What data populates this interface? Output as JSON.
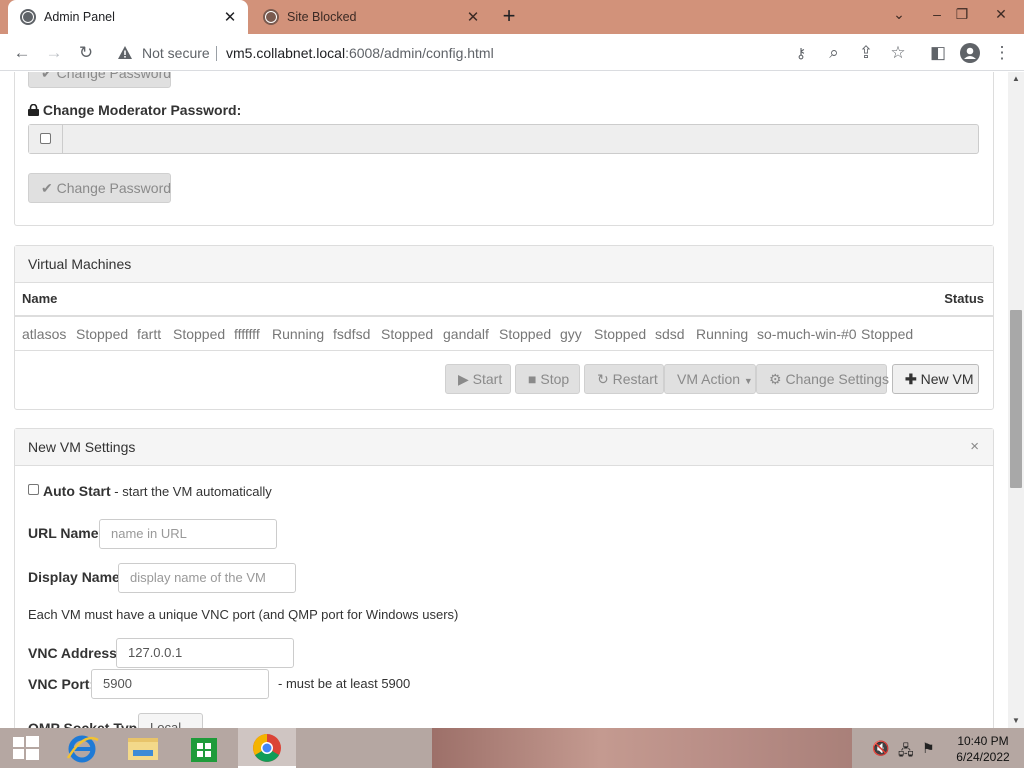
{
  "browser": {
    "tabs": [
      {
        "title": "Admin Panel",
        "active": true
      },
      {
        "title": "Site Blocked",
        "active": false
      }
    ],
    "new_tab": "+",
    "security_label": "Not secure",
    "url_host": "vm5.collabnet.local",
    "url_rest": ":6008/admin/config.html"
  },
  "password_section": {
    "change_password_label": "Change Password",
    "moderator_label": "Change Moderator Password:",
    "moderator_value": ""
  },
  "virtual_machines": {
    "heading": "Virtual Machines",
    "columns": [
      "Name",
      "Status"
    ],
    "entries": [
      {
        "name": "atlasos",
        "status": "Stopped"
      },
      {
        "name": "fartt",
        "status": "Stopped"
      },
      {
        "name": "fffffff",
        "status": "Running"
      },
      {
        "name": "fsdfsd",
        "status": "Stopped"
      },
      {
        "name": "gandalf",
        "status": "Stopped"
      },
      {
        "name": "gyy",
        "status": "Stopped"
      },
      {
        "name": "sdsd",
        "status": "Running"
      },
      {
        "name": "so-much-win-#0",
        "status": "Stopped"
      }
    ],
    "actions": {
      "start": "Start",
      "stop": "Stop",
      "restart": "Restart",
      "vm_action": "VM Action",
      "change_settings": "Change Settings",
      "new_vm": "New VM"
    }
  },
  "new_vm": {
    "heading": "New VM Settings",
    "close": "×",
    "auto_start_bold": "Auto Start",
    "auto_start_rest": " - start the VM automatically",
    "url_name_label": "URL Name:",
    "url_name_placeholder": "name in URL",
    "display_name_label": "Display Name:",
    "display_name_placeholder": "display name of the VM",
    "unique_note": "Each VM must have a unique VNC port (and QMP port for Windows users)",
    "vnc_address_label": "VNC Address:",
    "vnc_address_value": "127.0.0.1",
    "vnc_port_label": "VNC Port:",
    "vnc_port_value": "5900",
    "vnc_port_hint": "- must be at least 5900",
    "qmp_label": "QMP Socket Type:",
    "qmp_value": "Local"
  },
  "taskbar": {
    "time": "10:40 PM",
    "date": "6/24/2022"
  },
  "colors": {
    "tabstrip": "#d2927a",
    "panel_heading": "#f5f5f5",
    "border": "#dddddd"
  }
}
